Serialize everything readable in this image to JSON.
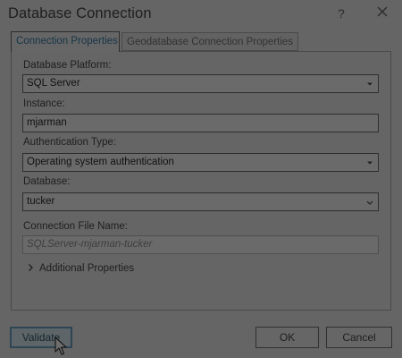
{
  "window": {
    "title": "Database Connection",
    "help_label": "?"
  },
  "tabs": [
    {
      "label": "Connection Properties",
      "active": true
    },
    {
      "label": "Geodatabase Connection Properties",
      "active": false
    }
  ],
  "form": {
    "platform": {
      "label": "Database Platform:",
      "value": "SQL Server"
    },
    "instance": {
      "label": "Instance:",
      "value": "mjarman"
    },
    "auth": {
      "label": "Authentication Type:",
      "value": "Operating system authentication"
    },
    "database": {
      "label": "Database:",
      "value": "tucker"
    },
    "connection_file": {
      "label": "Connection File Name:",
      "placeholder": "SQLServer-mjarman-tucker"
    },
    "additional": {
      "label": "Additional Properties"
    }
  },
  "buttons": {
    "validate": "Validate",
    "ok": "OK",
    "cancel": "Cancel"
  },
  "icons": {
    "close": "close-icon",
    "dropdown": "chevron-down-icon",
    "expand": "chevron-right-icon",
    "cursor": "mouse-pointer-icon"
  }
}
